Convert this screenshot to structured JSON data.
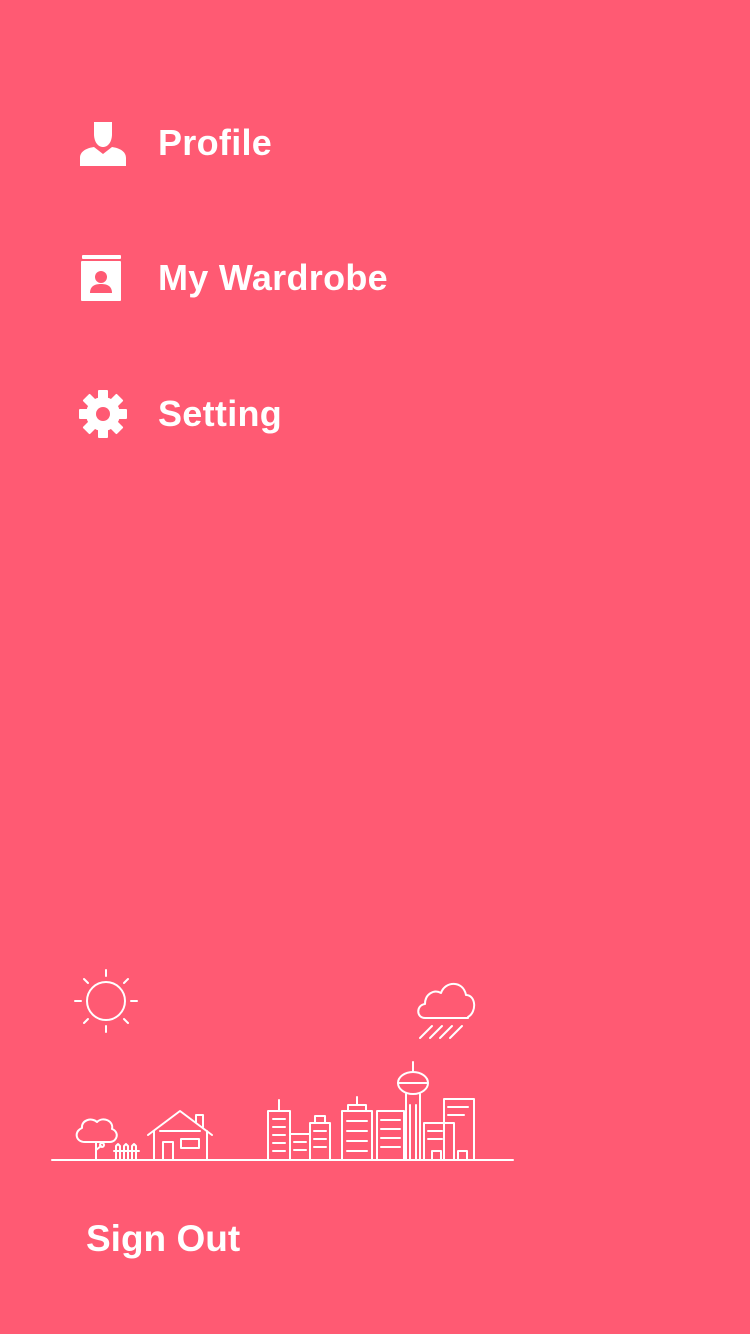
{
  "theme": {
    "background": "#ff5a73",
    "foreground": "#ffffff"
  },
  "menu": {
    "items": [
      {
        "label": "Profile",
        "icon": "person-icon"
      },
      {
        "label": "My Wardrobe",
        "icon": "contact-book-icon"
      },
      {
        "label": "Setting",
        "icon": "gear-icon"
      }
    ]
  },
  "illustration": {
    "icons": [
      "sun-icon",
      "rain-cloud-icon",
      "tree-icon",
      "house-icon",
      "city-skyline-icon"
    ]
  },
  "footer": {
    "sign_out_label": "Sign Out"
  }
}
